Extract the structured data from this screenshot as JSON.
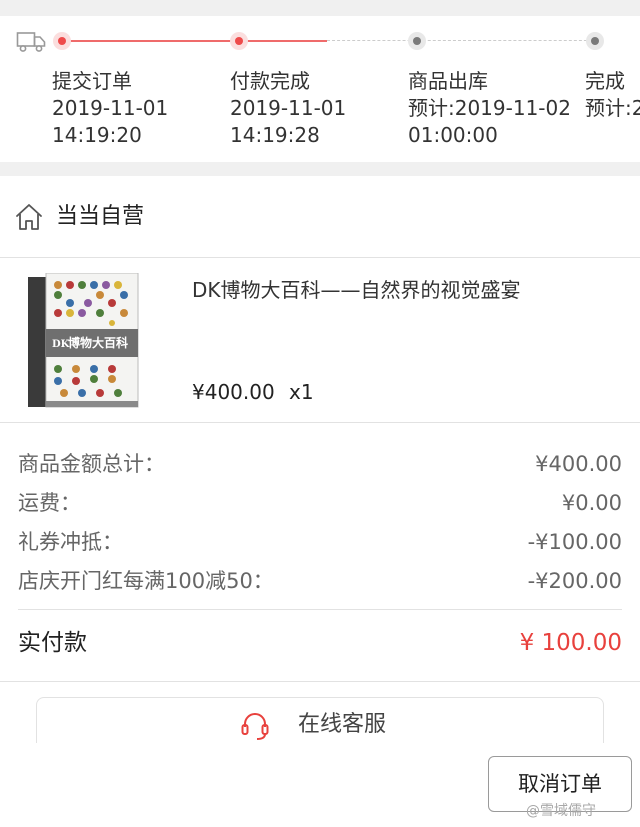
{
  "progress": {
    "steps": [
      {
        "title": "提交订单",
        "line1": "2019-11-01",
        "line2": "14:19:20"
      },
      {
        "title": "付款完成",
        "line1": "2019-11-01",
        "line2": "14:19:28"
      },
      {
        "title": "商品出库",
        "line1": "预计:2019-11-02",
        "line2": "01:00:00"
      },
      {
        "title": "完成",
        "line1": "预计:2",
        "line2": ""
      }
    ]
  },
  "store": {
    "name": "当当自营",
    "icon": "home-icon"
  },
  "product": {
    "title": "DK博物大百科——自然界的视觉盛宴",
    "price": "¥400.00",
    "qty": "x1",
    "cover": {
      "brand": "DK",
      "title": "博物大百科"
    }
  },
  "summary": {
    "rows": [
      {
        "label": "商品金额总计：",
        "value": "¥400.00"
      },
      {
        "label": "运费：",
        "value": "¥0.00"
      },
      {
        "label": "礼券冲抵：",
        "value": "-¥100.00"
      },
      {
        "label": "店庆开门红每满100减50：",
        "value": "-¥200.00"
      }
    ],
    "total_label": "实付款",
    "total_value": "¥ 100.00"
  },
  "service": {
    "label": "在线客服",
    "icon": "headset-icon"
  },
  "actions": {
    "cancel_label": "取消订单"
  },
  "watermark": "@雪域儒守",
  "colors": {
    "accent": "#e8413d",
    "progress_active": "#ee4b4b",
    "progress_inactive": "#7a7a7a"
  }
}
